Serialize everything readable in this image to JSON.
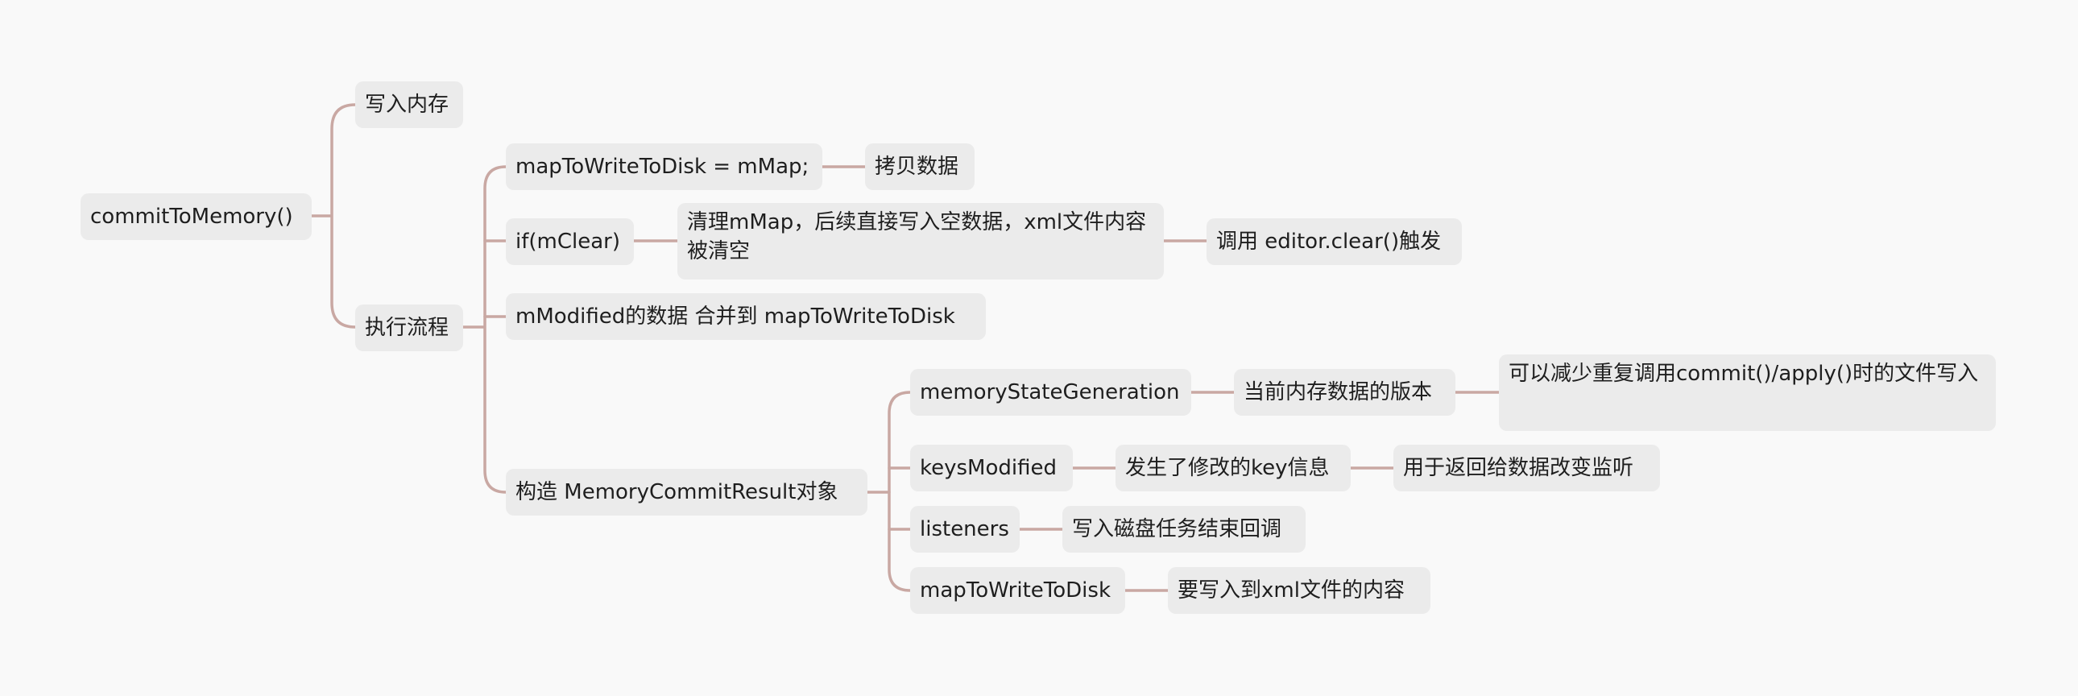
{
  "mindmap": {
    "root": "commitToMemory()",
    "write_memory": "写入内存",
    "exec_flow": "执行流程",
    "map_assign": "mapToWriteToDisk = mMap;",
    "copy_data": "拷贝数据",
    "if_clear": "if(mClear)",
    "clear_desc": "清理mMap，后续直接写入空数据，xml文件内容被清空",
    "clear_trigger": "调用 editor.clear()触发",
    "merge": "mModified的数据 合并到 mapToWriteToDisk",
    "construct": "构造 MemoryCommitResult对象",
    "msg": "memoryStateGeneration",
    "msg_desc": "当前内存数据的版本",
    "msg_note": "可以减少重复调用commit()/apply()时的文件写入",
    "keys_mod": "keysModified",
    "keys_desc": "发生了修改的key信息",
    "keys_note": "用于返回给数据改变监听",
    "listeners": "listeners",
    "listeners_desc": "写入磁盘任务结束回调",
    "map_disk": "mapToWriteToDisk",
    "map_disk_desc": "要写入到xml文件的内容"
  },
  "colors": {
    "background": "#f9f9f9",
    "node_fill": "#ebebeb",
    "connector": "#c9a8a3",
    "text": "#1e1e1e"
  }
}
